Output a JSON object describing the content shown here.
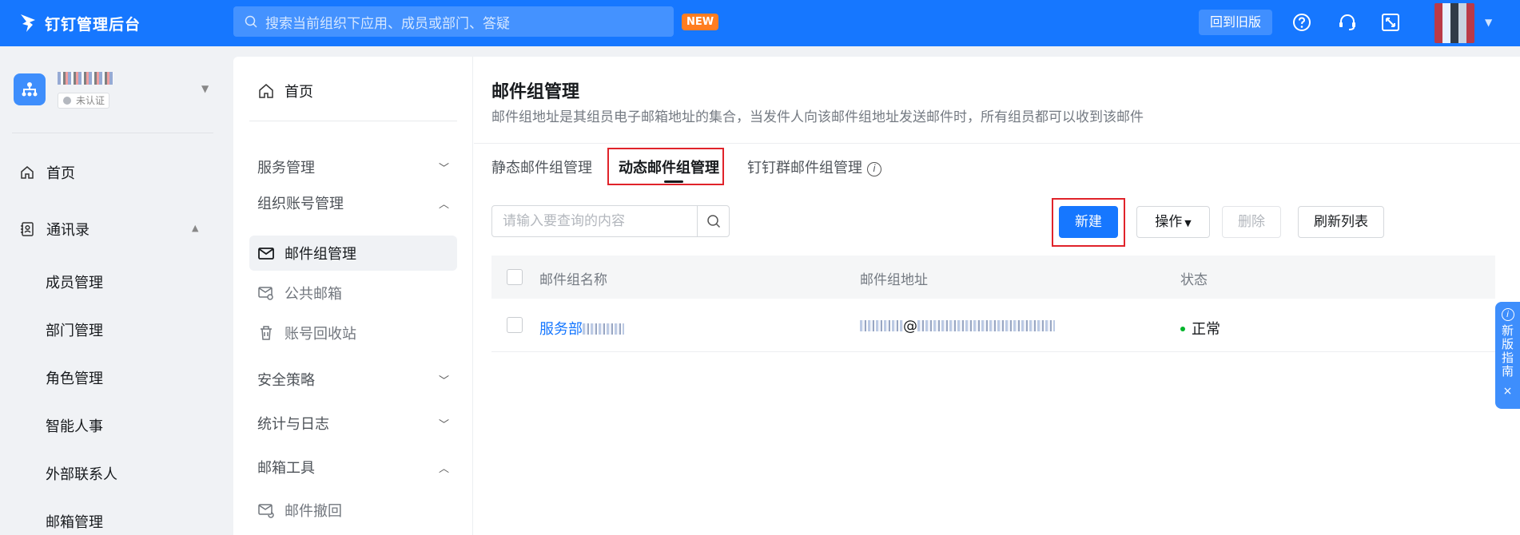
{
  "topbar": {
    "brand": "钉钉管理后台",
    "search_placeholder": "搜索当前组织下应用、成员或部门、答疑",
    "new_badge": "NEW",
    "old_version_label": "回到旧版"
  },
  "leftnav": {
    "org_status": "未认证",
    "items": [
      {
        "label": "首页"
      },
      {
        "label": "通讯录"
      }
    ],
    "contacts_sub": [
      "成员管理",
      "部门管理",
      "角色管理",
      "智能人事",
      "外部联系人",
      "邮箱管理"
    ]
  },
  "subnav": {
    "home": "首页",
    "groups": {
      "service": "服务管理",
      "org_account": "组织账号管理",
      "security": "安全策略",
      "stats": "统计与日志",
      "mail_tools": "邮箱工具"
    },
    "items": {
      "mail_group": "邮件组管理",
      "public_mailbox": "公共邮箱",
      "recycle": "账号回收站",
      "mail_recall": "邮件撤回"
    }
  },
  "content": {
    "title": "邮件组管理",
    "description": "邮件组地址是其组员电子邮箱地址的集合，当发件人向该邮件组地址发送邮件时，所有组员都可以收到该邮件",
    "tabs": [
      "静态邮件组管理",
      "动态邮件组管理",
      "钉钉群邮件组管理"
    ],
    "active_tab": "动态邮件组管理",
    "query_placeholder": "请输入要查询的内容",
    "buttons": {
      "create": "新建",
      "operate": "操作",
      "delete": "删除",
      "refresh": "刷新列表"
    },
    "table": {
      "columns": [
        "邮件组名称",
        "邮件组地址",
        "状态"
      ],
      "rows": [
        {
          "name": "服务部",
          "address_at": "@",
          "status": "正常"
        }
      ]
    }
  },
  "guide": {
    "label_lines": [
      "新",
      "版",
      "指",
      "南"
    ],
    "close": "×"
  },
  "colors": {
    "brand": "#1677ff",
    "badge": "#ff7d20",
    "highlight": "#e0232a",
    "status_ok": "#00b42a"
  }
}
